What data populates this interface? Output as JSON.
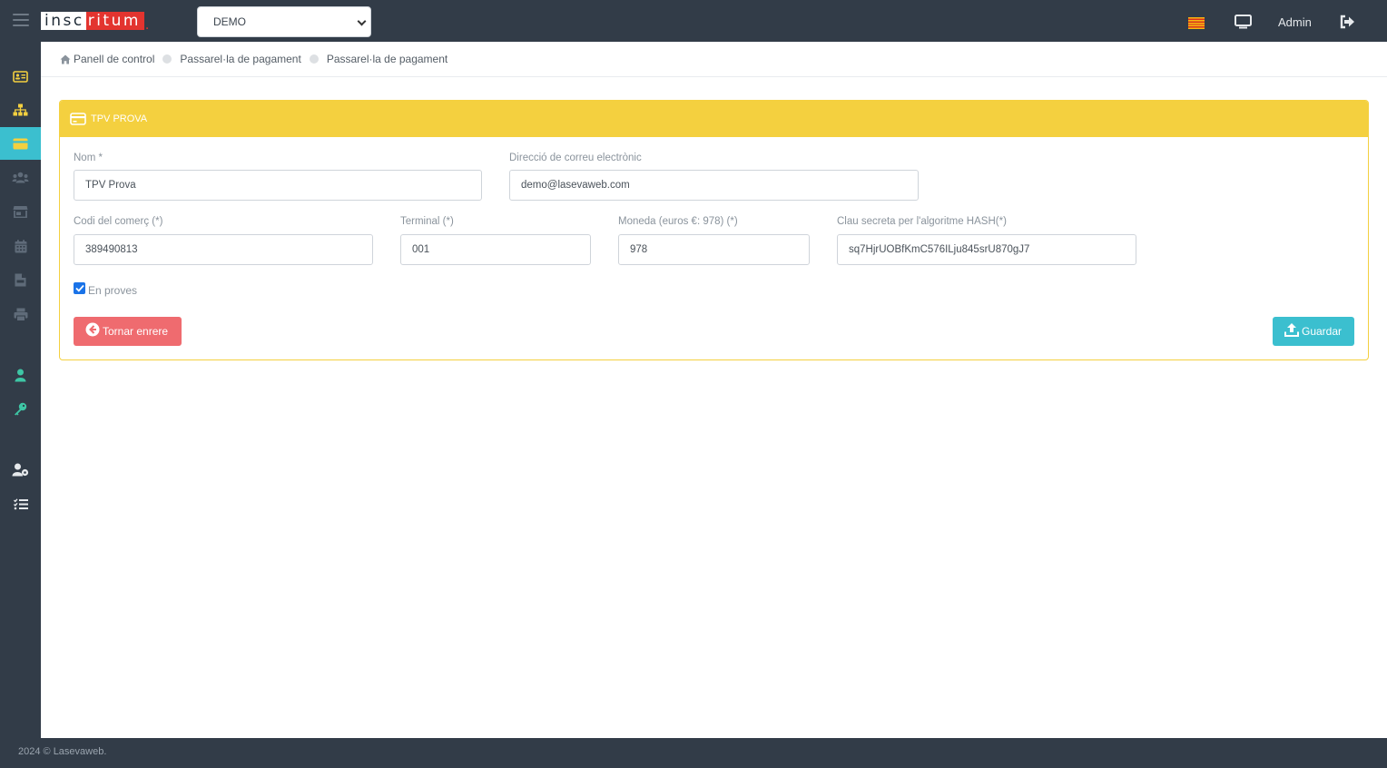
{
  "header": {
    "logo_part1": "insc",
    "logo_part2": "ritum",
    "logo_dot": ".",
    "org_select": "DEMO",
    "user": "Admin"
  },
  "sidebar": {
    "items": [
      {
        "icon": "id-card-icon"
      },
      {
        "icon": "sitemap-icon"
      },
      {
        "icon": "credit-card-icon",
        "active": true
      },
      {
        "icon": "users-icon"
      },
      {
        "icon": "store-icon"
      },
      {
        "icon": "calendar-icon"
      },
      {
        "icon": "file-invoice-icon"
      },
      {
        "icon": "printer-icon"
      },
      {
        "icon": "user-icon"
      },
      {
        "icon": "key-icon"
      },
      {
        "icon": "user-cog-icon"
      },
      {
        "icon": "tasks-icon"
      }
    ]
  },
  "breadcrumb": {
    "home": "Panell de control",
    "level1": "Passarel·la de pagament",
    "level2": "Passarel·la de pagament"
  },
  "card": {
    "title": "TPV PROVA"
  },
  "form": {
    "name_label": "Nom *",
    "name_value": "TPV Prova",
    "email_label": "Direcció de correu electrònic",
    "email_value": "demo@lasevaweb.com",
    "merchant_label": "Codi del comerç (*)",
    "merchant_value": "389490813",
    "terminal_label": "Terminal (*)",
    "terminal_value": "001",
    "currency_label": "Moneda (euros €: 978) (*)",
    "currency_value": "978",
    "secret_label": "Clau secreta per l'algoritme HASH(*)",
    "secret_value": "sq7HjrUOBfKmC576ILju845srU870gJ7",
    "test_label": "En proves",
    "test_checked": true
  },
  "buttons": {
    "back": "Tornar enrere",
    "save": "Guardar"
  },
  "footer": {
    "text": "2024 © Lasevaweb."
  },
  "colors": {
    "topbar": "#323c48",
    "accent": "#3bbfcf",
    "card_header": "#f4d03f",
    "back_button": "#ef6b6f",
    "logo_red": "#e3342f"
  }
}
